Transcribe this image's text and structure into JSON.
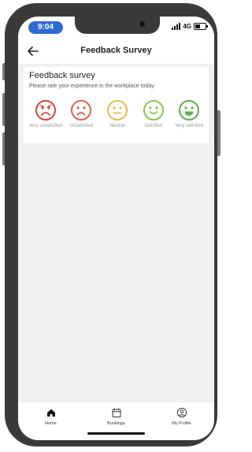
{
  "status_bar": {
    "time": "9:04",
    "network": "4G"
  },
  "nav": {
    "title": "Feedback Survey"
  },
  "survey": {
    "title": "Feedback survey",
    "subtitle": "Please rate your experience in the workplace today",
    "options": [
      {
        "label": "Very unsatisfied",
        "icon": "very-unsatisfied-face-icon",
        "color": "#d9443f",
        "mood": "very-sad"
      },
      {
        "label": "Unsatisfied",
        "icon": "unsatisfied-face-icon",
        "color": "#e0604a",
        "mood": "sad"
      },
      {
        "label": "Neutral",
        "icon": "neutral-face-icon",
        "color": "#e9b949",
        "mood": "neutral"
      },
      {
        "label": "Satisfied",
        "icon": "satisfied-face-icon",
        "color": "#8cc64a",
        "mood": "happy"
      },
      {
        "label": "Very satisfied",
        "icon": "very-satisfied-face-icon",
        "color": "#5fb04b",
        "mood": "very-happy"
      }
    ]
  },
  "tab_bar": {
    "tabs": [
      {
        "label": "Home",
        "icon": "home-icon"
      },
      {
        "label": "Bookings",
        "icon": "calendar-icon"
      },
      {
        "label": "My Profile",
        "icon": "profile-icon"
      }
    ]
  },
  "colors": {
    "accent": "#2d6bd4",
    "phone_frame": "#3a3a3a",
    "background": "#f0f0f2"
  }
}
